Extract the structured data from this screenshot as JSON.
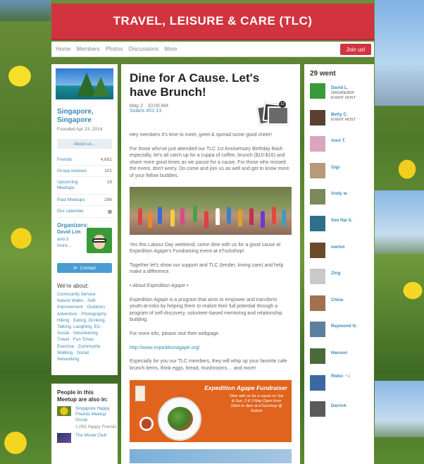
{
  "header": {
    "title": "TRAVEL, LEISURE & CARE (TLC)"
  },
  "nav": {
    "items": [
      "Home",
      "Members",
      "Photos",
      "Discussions",
      "More"
    ],
    "join_label": "Join us!"
  },
  "sidebar": {
    "group_name": "Singapore, Singapore",
    "founded": "Founded Apr 23, 2014",
    "about_label": "About us...",
    "stats": [
      {
        "label": "Friends",
        "value": "4,691"
      },
      {
        "label": "Group reviews",
        "value": "101"
      },
      {
        "label": "Upcoming Meetups",
        "value": "19"
      },
      {
        "label": "Past Meetups",
        "value": "286"
      },
      {
        "label": "Our calendar",
        "value": ""
      }
    ],
    "organizers_label": "Organizers:",
    "organizer_name": "David Lim",
    "organizer_more": "and 3 more...",
    "contact_label": "Contact",
    "about_heading": "We're about:",
    "topics": "Community Service · Nature Walks · Self-Improvement · Outdoors · Adventure · Photography · Hiking · Eating, Drinking, Talking, Laughing, Etc · Social · Volunteering · Travel · Fun Times · Exercise · Community · Walking · Social Networking"
  },
  "also_in": {
    "heading": "People in this Meetup are also in:",
    "items": [
      {
        "name": "Singapore Happy Friends Meetup Group",
        "sub": "1,093 Happy Friends"
      },
      {
        "name": "The Movie Club",
        "sub": ""
      }
    ]
  },
  "event": {
    "title": "Dine for A Cause. Let's have Brunch!",
    "date": "May 2 · 10:00 AM",
    "venue": "Solaris #01-13",
    "photo_count": "12",
    "paragraphs": [
      "Hey members it's time to meet, greet & spread some good cheer!",
      "For those who've just attended our TLC 1st Anniversary Birthday Bash especially, let's all catch up for a cuppa of coffee, brunch ($10-$16) and share more good times as we pause for a cause.  For those who missed the event, don't worry. Do come and join us as well and get to know more of your fellow buddies.",
      "Yes this Labour Day weekend, come dine with us for a good cause at Expedition Agape's Fundraising event at eTuckshop!",
      "Together let's show our support and TLC (tender, loving care) and help make a difference.",
      "• About Expedition Agape •",
      "Expedition Agape is a program that aims to empower and transform youth-at-risks by helping them to realize their full potential through a program of self-discovery, volunteer-based mentoring and relationship building.",
      "For more info, please visit their webpage.",
      "http://www.expeditionagape.org/",
      "Especially for you our TLC members, they will whip up your favorite cafe brunch items, think eggs, bread, mushrooms.... and more!"
    ],
    "poster": {
      "title": "Expedition Agape Fundraiser",
      "lines": "Dine with us for a cause on Sat & Sun, 2 & 3 May Open from 10am to 4pm at eTuckshop @ Solaris"
    }
  },
  "attendees": {
    "count_label": "29 went",
    "members": [
      {
        "name": "David L.",
        "role1": "ORGANIZER",
        "role2": "EVENT HOST",
        "plus": "",
        "color": "#3a9a3a"
      },
      {
        "name": "Betty C.",
        "role1": "EVENT HOST",
        "role2": "",
        "plus": "",
        "color": "#5a4030"
      },
      {
        "name": "Anni T.",
        "role1": "",
        "role2": "",
        "plus": "",
        "color": "#d9a6c0"
      },
      {
        "name": "Gigi",
        "role1": "",
        "role2": "",
        "plus": "",
        "color": "#b69a7a"
      },
      {
        "name": "Andy w.",
        "role1": "",
        "role2": "",
        "plus": "",
        "color": "#7a8a5a"
      },
      {
        "name": "See Hai S.",
        "role1": "",
        "role2": "",
        "plus": "",
        "color": "#2f6f8a"
      },
      {
        "name": "merlot",
        "role1": "",
        "role2": "",
        "plus": "",
        "color": "#6a4a2a"
      },
      {
        "name": "Zing",
        "role1": "",
        "role2": "",
        "plus": "",
        "color": "#c9c9c9"
      },
      {
        "name": "Chloe",
        "role1": "",
        "role2": "",
        "plus": "",
        "color": "#a07050"
      },
      {
        "name": "Raymond N.",
        "role1": "",
        "role2": "",
        "plus": "",
        "color": "#5f7f9f"
      },
      {
        "name": "Hanson",
        "role1": "",
        "role2": "",
        "plus": "",
        "color": "#4a6a3a"
      },
      {
        "name": "Rieko",
        "role1": "",
        "role2": "",
        "plus": "+1",
        "color": "#3a6aa0"
      },
      {
        "name": "Darrick",
        "role1": "",
        "role2": "",
        "plus": "",
        "color": "#5a5a5a"
      }
    ]
  }
}
